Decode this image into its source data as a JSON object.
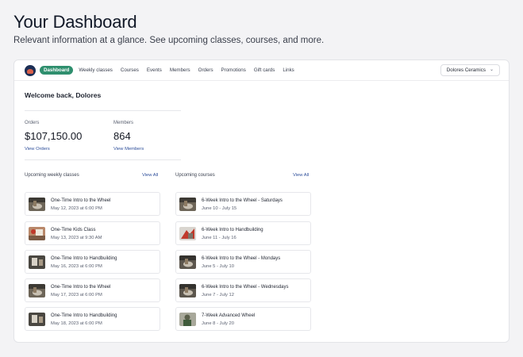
{
  "header": {
    "title": "Your Dashboard",
    "subtitle": "Relevant information at a glance. See upcoming classes, courses, and more."
  },
  "nav": {
    "items": [
      "Dashboard",
      "Weekly classes",
      "Courses",
      "Events",
      "Members",
      "Orders",
      "Promotions",
      "Gift cards",
      "Links"
    ],
    "active": "Dashboard",
    "org_selector": "Dolores Ceramics",
    "accent_color": "#2f8f6e"
  },
  "welcome": "Welcome back, Dolores",
  "stats": {
    "orders": {
      "label": "Orders",
      "value": "$107,150.00",
      "link": "View Orders"
    },
    "members": {
      "label": "Members",
      "value": "864",
      "link": "View Members"
    }
  },
  "classes": {
    "heading": "Upcoming weekly classes",
    "view_all": "View All",
    "items": [
      {
        "title": "One-Time Intro to the Wheel",
        "date": "May 12, 2023 at 6:00 PM",
        "thumb": "wheel"
      },
      {
        "title": "One-Time Kids Class",
        "date": "May 13, 2023 at 9:30 AM",
        "thumb": "kids"
      },
      {
        "title": "One-Time Intro to Handbuilding",
        "date": "May 16, 2023 at 6:00 PM",
        "thumb": "handbuilding"
      },
      {
        "title": "One-Time Intro to the Wheel",
        "date": "May 17, 2023 at 6:00 PM",
        "thumb": "wheel"
      },
      {
        "title": "One-Time Intro to Handbuilding",
        "date": "May 18, 2023 at 6:00 PM",
        "thumb": "handbuilding"
      }
    ]
  },
  "courses": {
    "heading": "Upcoming courses",
    "view_all": "View All",
    "items": [
      {
        "title": "6-Week Intro to the Wheel - Saturdays",
        "date": "June 10 - July 15",
        "thumb": "wheel"
      },
      {
        "title": "6-Week Intro to Handbuilding",
        "date": "June 11 - July 16",
        "thumb": "handbuilding-red"
      },
      {
        "title": "6-Week Intro to the Wheel - Mondays",
        "date": "June 5 - July 10",
        "thumb": "wheel"
      },
      {
        "title": "6-Week Intro to the Wheel - Wednesdays",
        "date": "June 7 - July 12",
        "thumb": "wheel"
      },
      {
        "title": "7-Week Advanced Wheel",
        "date": "June 8 - July 20",
        "thumb": "advanced"
      }
    ]
  }
}
